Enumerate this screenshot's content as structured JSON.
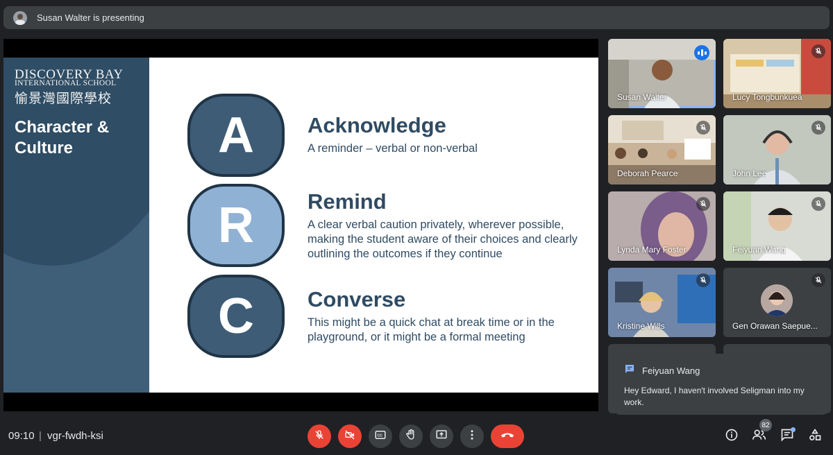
{
  "presenting": {
    "text": "Susan Walter is presenting"
  },
  "slide": {
    "school_name": "DISCOVERY BAY",
    "school_sub": "INTERNATIONAL SCHOOL",
    "school_cjk": "愉景灣國際學校",
    "side_title": "Character & Culture",
    "items": [
      {
        "letter": "A",
        "heading": "Acknowledge",
        "description": "A reminder – verbal or non-verbal"
      },
      {
        "letter": "R",
        "heading": "Remind",
        "description": "A clear verbal caution privately, wherever possible, making the student aware of their choices and clearly outlining the outcomes if they continue"
      },
      {
        "letter": "C",
        "heading": "Converse",
        "description": "This might be a quick chat at break time or in the playground, or it might be a formal meeting"
      }
    ]
  },
  "participants": [
    {
      "name": "Susan Walter",
      "speaking": true,
      "bg": "#b9b6ad"
    },
    {
      "name": "Lucy Tongbunkuea",
      "speaking": false,
      "bg": "#d8c7a8"
    },
    {
      "name": "Deborah Pearce",
      "speaking": false,
      "bg": "#c9b49a"
    },
    {
      "name": "John Lee",
      "speaking": false,
      "bg": "#b8c0b3"
    },
    {
      "name": "Lynda Mary Foster",
      "speaking": false,
      "bg": "#a89a9c"
    },
    {
      "name": "Feiyuan Wang",
      "speaking": false,
      "bg": "#c8c9c3"
    },
    {
      "name": "Kristine Wills",
      "speaking": false,
      "bg": "#7d8fa6"
    },
    {
      "name": "Gen Orawan Saepue...",
      "speaking": false,
      "bg": "#3c4043"
    }
  ],
  "chat_toast": {
    "sender": "Feiyuan Wang",
    "message": "Hey Edward, I haven't involved Seligman into my work."
  },
  "bottom": {
    "time": "09:10",
    "separator": "|",
    "meeting_code": "vgr-fwdh-ksi",
    "people_count": "82"
  },
  "colors": {
    "accent": "#8ab4f8",
    "danger": "#ea4335",
    "speaking": "#1a73e8"
  }
}
